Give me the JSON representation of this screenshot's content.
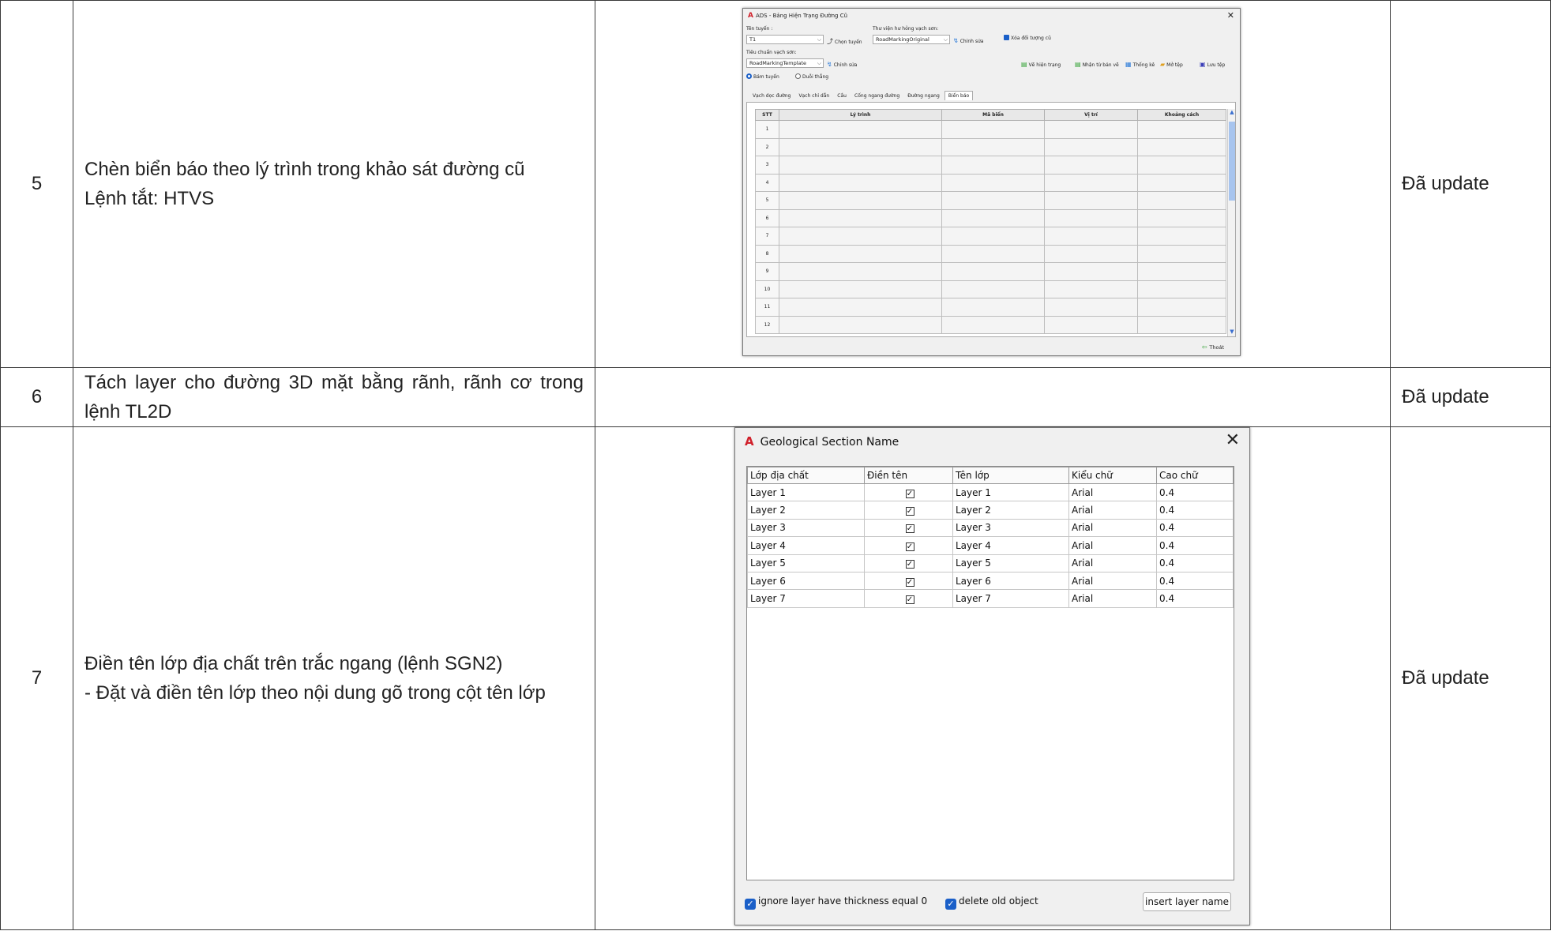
{
  "rows": [
    {
      "number": "5",
      "description": [
        "Chèn biển báo theo lý trình trong khảo sát đường cũ",
        "Lệnh tắt: HTVS"
      ],
      "status": "Đã update"
    },
    {
      "number": "6",
      "description": [
        "Tách layer cho đường 3D mặt bằng rãnh, rãnh cơ trong lệnh TL2D"
      ],
      "status": "Đã update"
    },
    {
      "number": "7",
      "description": [
        "Điền tên lớp địa chất trên trắc ngang (lệnh SGN2)",
        "- Đặt và điền tên lớp theo nội dung gõ trong cột tên lớp"
      ],
      "status": "Đã update"
    }
  ],
  "dialog1": {
    "title": "ADS - Bảng Hiện Trạng Đường Cũ",
    "route_label": "Tên tuyến :",
    "route_value": "T1",
    "choose_route": "Chọn tuyến",
    "library_label": "Thư viện hư hỏng vạch sơn:",
    "library_value": "RoadMarkingOriginal",
    "edit": "Chỉnh sửa",
    "delete_old": "Xóa đối tượng cũ",
    "standard_label": "Tiêu chuẩn vạch sơn:",
    "standard_value": "RoadMarkingTemplate",
    "tools": [
      "Vẽ hiện trạng",
      "Nhận từ bản vẽ",
      "Thống kê",
      "Mở tệp",
      "Lưu tệp"
    ],
    "radios": [
      "Bám tuyến",
      "Duỗi thẳng"
    ],
    "tabs": [
      "Vạch dọc đường",
      "Vạch chỉ dẫn",
      "Cầu",
      "Cống ngang đường",
      "Đường ngang",
      "Biển báo"
    ],
    "columns": [
      "STT",
      "Lý trình",
      "Mã biển",
      "Vị trí",
      "Khoảng cách"
    ],
    "row_numbers": [
      "1",
      "2",
      "3",
      "4",
      "5",
      "6",
      "7",
      "8",
      "9",
      "10",
      "11",
      "12"
    ],
    "exit": "Thoát"
  },
  "dialog2": {
    "title": "Geological Section Name",
    "columns": [
      "Lớp địa chất",
      "Điền tên",
      "Tên lớp",
      "Kiểu chữ",
      "Cao chữ"
    ],
    "rows": [
      {
        "layer": "Layer 1",
        "fill": "☑",
        "name": "Layer 1",
        "font": "Arial",
        "height": "0.4"
      },
      {
        "layer": "Layer 2",
        "fill": "☑",
        "name": "Layer 2",
        "font": "Arial",
        "height": "0.4"
      },
      {
        "layer": "Layer 3",
        "fill": "☑",
        "name": "Layer 3",
        "font": "Arial",
        "height": "0.4"
      },
      {
        "layer": "Layer 4",
        "fill": "☑",
        "name": "Layer 4",
        "font": "Arial",
        "height": "0.4"
      },
      {
        "layer": "Layer 5",
        "fill": "☑",
        "name": "Layer 5",
        "font": "Arial",
        "height": "0.4"
      },
      {
        "layer": "Layer 6",
        "fill": "☑",
        "name": "Layer 6",
        "font": "Arial",
        "height": "0.4"
      },
      {
        "layer": "Layer 7",
        "fill": "☑",
        "name": "Layer 7",
        "font": "Arial",
        "height": "0.4"
      }
    ],
    "ignore_label": "ignore layer have thickness equal 0",
    "delete_label": "delete old object",
    "insert_button": "insert layer name"
  },
  "colors": {
    "accent_blue": "#1a5fc8",
    "autocad_red": "#d0202a",
    "border": "#3a3a3a"
  }
}
